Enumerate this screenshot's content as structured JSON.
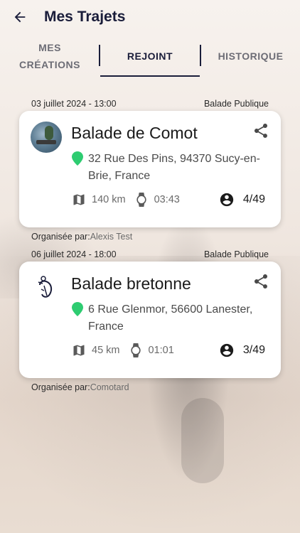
{
  "header": {
    "title": "Mes Trajets",
    "back_icon": "arrow-left-icon"
  },
  "tabs": [
    {
      "label": "MES\nCRÉATIONS",
      "active": false
    },
    {
      "label": "REJOINT",
      "active": true
    },
    {
      "label": "HISTORIQUE",
      "active": false
    }
  ],
  "rides": [
    {
      "datetime": "03 juillet 2024 - 13:00",
      "visibility": "Balade Publique",
      "title": "Balade de Comot",
      "address": "32 Rue Des Pins, 94370 Sucy-en-Brie, France",
      "distance": "140 km",
      "duration": "03:43",
      "participants": "4/49",
      "organizer_label": "Organisée par:",
      "organizer_name": "Alexis Test",
      "avatar": "lake-photo"
    },
    {
      "datetime": "06 juillet 2024 - 18:00",
      "visibility": "Balade Publique",
      "title": "Balade bretonne",
      "address": "6 Rue Glenmor, 56600 Lanester, France",
      "distance": "45 km",
      "duration": "01:01",
      "participants": "3/49",
      "organizer_label": "Organisée par:",
      "organizer_name": "Comotard",
      "avatar": "helmet-logo"
    }
  ],
  "colors": {
    "accent": "#1a1d3a",
    "pin": "#2ecc71",
    "card": "#ffffff",
    "muted_text": "#6a6a6a"
  },
  "icons": [
    "arrow-left-icon",
    "share-icon",
    "location-pin-icon",
    "map-icon",
    "watch-icon",
    "user-circle-icon"
  ]
}
